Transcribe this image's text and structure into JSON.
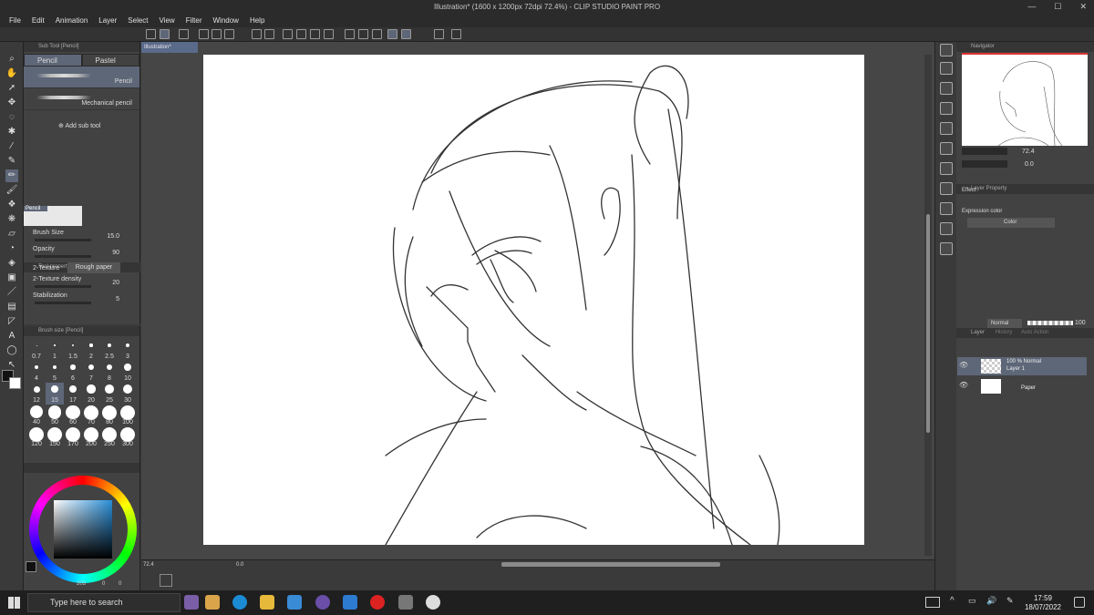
{
  "window": {
    "title": "Illustration* (1600 x 1200px 72dpi 72.4%) - CLIP STUDIO PAINT PRO"
  },
  "menu": [
    "File",
    "Edit",
    "Animation",
    "Layer",
    "Select",
    "View",
    "Filter",
    "Window",
    "Help"
  ],
  "document_tab": "Illustration*",
  "sub_tool": {
    "title": "Sub Tool [Pencil]",
    "tabs": [
      "Pencil",
      "Pastel"
    ],
    "brushes": [
      "Pencil",
      "Mechanical pencil"
    ],
    "add_label": "Add sub tool"
  },
  "tool_property": {
    "title": "Tool property [Pencil]",
    "preview_label": "Pencil",
    "brush_size_label": "Brush Size",
    "brush_size_value": "15.0",
    "opacity_label": "Opacity",
    "opacity_value": "90",
    "texture_label": "2-Texture",
    "texture_value": "Rough paper",
    "texture_density_label": "2-Texture density",
    "texture_density_value": "20",
    "stabilization_label": "Stabilization",
    "stabilization_value": "5"
  },
  "brush_size_panel": {
    "title": "Brush size [Pencil]",
    "sizes": [
      "0.7",
      "1",
      "1.5",
      "2",
      "2.5",
      "3",
      "4",
      "5",
      "6",
      "7",
      "8",
      "10",
      "12",
      "15",
      "17",
      "20",
      "25",
      "30",
      "40",
      "50",
      "60",
      "70",
      "80",
      "100",
      "120",
      "150",
      "170",
      "200",
      "250",
      "300"
    ],
    "selected": "15"
  },
  "color_panel": {
    "sub_value": "203",
    "extra_values": [
      "0",
      "0"
    ]
  },
  "canvas_status": {
    "zoom": "72.4",
    "angle": "0.0"
  },
  "navigator": {
    "title": "Navigator",
    "zoom": "72.4",
    "angle": "0.0"
  },
  "layer_property": {
    "title": "Layer Property",
    "effect_label": "Effect",
    "expression_label": "Expression color",
    "expression_value": "Color"
  },
  "layer_panel": {
    "tabs": [
      "Layer",
      "History",
      "Auto Action"
    ],
    "blend_mode": "Normal",
    "opacity": "100",
    "layers": [
      {
        "name": "Layer 1",
        "info": "100 % Normal"
      },
      {
        "name": "Paper",
        "info": ""
      }
    ]
  },
  "taskbar": {
    "search_placeholder": "Type here to search",
    "time": "17:59",
    "date": "18/07/2022"
  }
}
